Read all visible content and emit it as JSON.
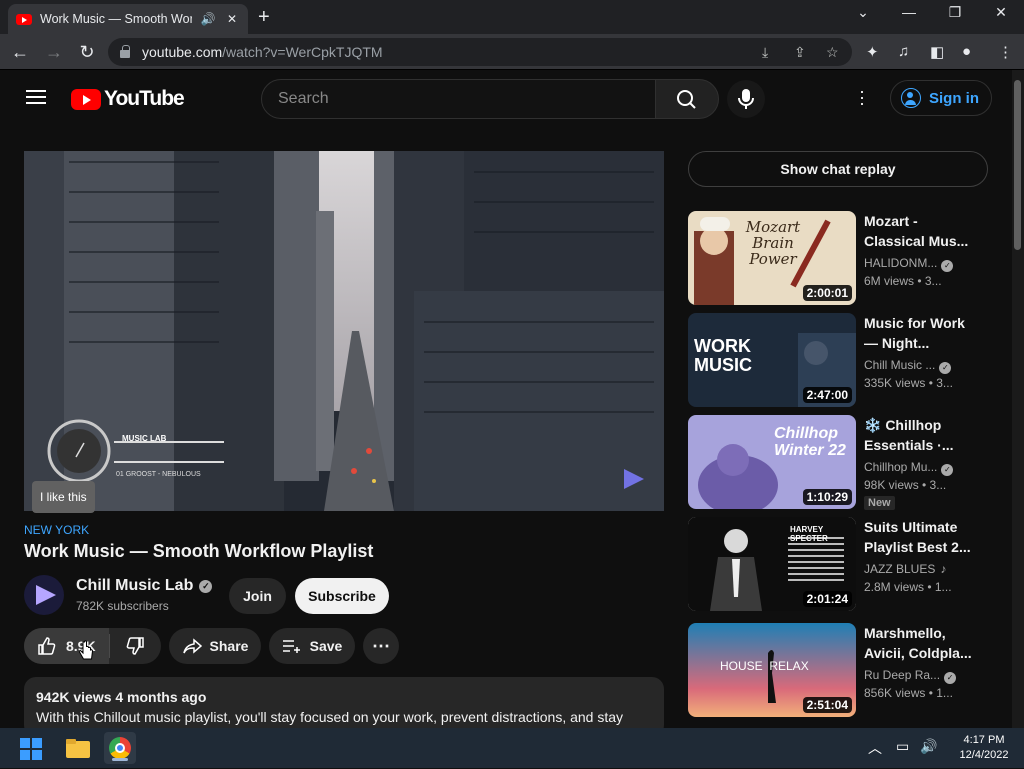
{
  "browser": {
    "tab_title": "Work Music — Smooth Workflow Playlist",
    "url_domain": "youtube.com",
    "url_path": "/watch?v=WerCpkTJQTM"
  },
  "header": {
    "logo_text": "YouTube",
    "search_placeholder": "Search",
    "signin_label": "Sign in"
  },
  "video": {
    "overlay_brand": "MUSIC LAB",
    "overlay_track": "01  GROOST - NEBULOUS",
    "tooltip": "I like this",
    "hashtag": "NEW YORK",
    "title": "Work Music — Smooth Workflow Playlist",
    "channel": "Chill Music Lab",
    "subscribers": "782K subscribers",
    "join_label": "Join",
    "subscribe_label": "Subscribe",
    "likes": "8.9K",
    "share_label": "Share",
    "save_label": "Save",
    "desc_meta": "942K views  4 months ago",
    "desc_text": "With this Chillout music playlist, you'll stay focused on your work, prevent distractions, and stay"
  },
  "sidebar": {
    "chat_replay": "Show chat replay",
    "recommendations": [
      {
        "title": "Mozart - Classical Mus...",
        "channel": "HALIDONM...",
        "views": "6M views • 3...",
        "duration": "2:00:01",
        "thumb_text": "Mozart Brain Power",
        "badge": ""
      },
      {
        "title": "Music for Work — Night...",
        "channel": "Chill Music ...",
        "views": "335K views • 3...",
        "duration": "2:47:00",
        "thumb_text": "WORK MUSIC",
        "badge": ""
      },
      {
        "title": "❄️ Chillhop Essentials ·...",
        "channel": "Chillhop Mu...",
        "views": "98K views • 3...",
        "duration": "1:10:29",
        "thumb_text": "Chillhop Winter 22",
        "badge": "New"
      },
      {
        "title": "Suits Ultimate Playlist Best 2...",
        "channel": "JAZZ BLUES",
        "views": "2.8M views • 1...",
        "duration": "2:01:24",
        "thumb_text": "HARVEY SPECTER",
        "badge": ""
      },
      {
        "title": "Marshmello, Avicii, Coldpla...",
        "channel": "Ru Deep Ra...",
        "views": "856K views • 1...",
        "duration": "2:51:04",
        "thumb_text": "HOUSE  RELAX",
        "badge": ""
      }
    ]
  },
  "taskbar": {
    "time": "4:17 PM",
    "date": "12/4/2022"
  }
}
